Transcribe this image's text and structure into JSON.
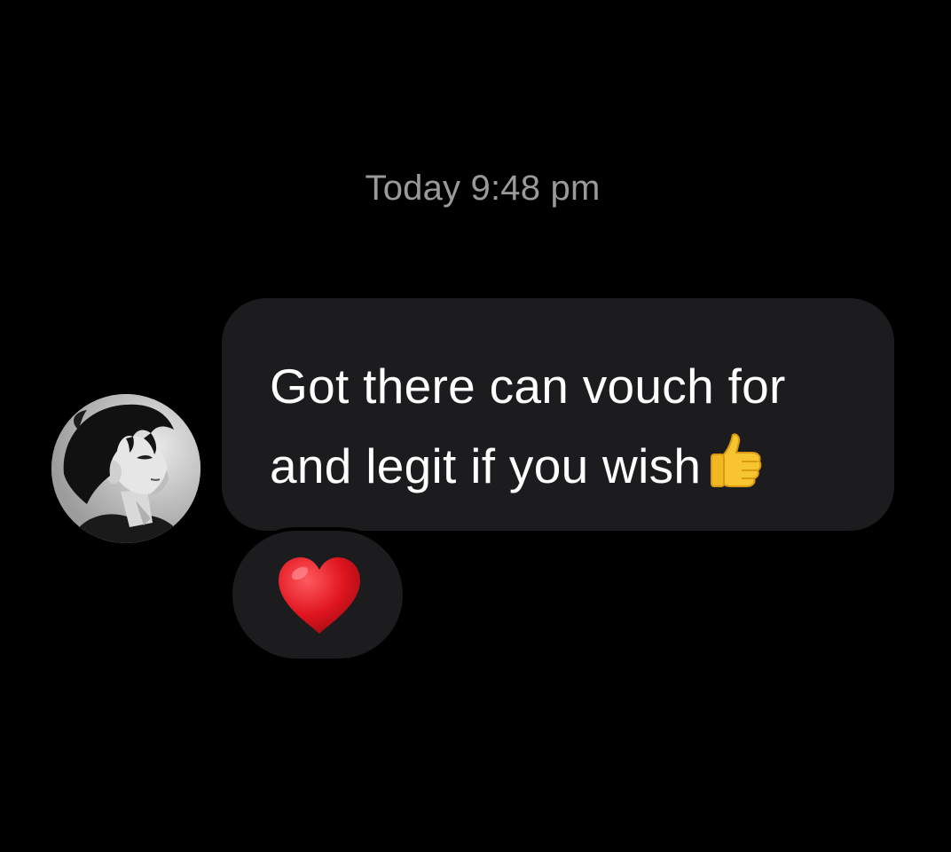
{
  "chat": {
    "timestamp": "Today 9:48 pm",
    "message": {
      "text": "Got there can vouch for\nand legit if you wish",
      "trailing_emoji": "thumbs-up-icon"
    },
    "reaction": {
      "emoji": "red-heart-icon"
    },
    "sender_avatar": "avatar"
  },
  "colors": {
    "background": "#000000",
    "bubble": "#1c1c1e",
    "timestamp_text": "#9a9a9a",
    "message_text": "#ffffff",
    "heart": "#e0151f",
    "thumb": "#f7c530"
  }
}
